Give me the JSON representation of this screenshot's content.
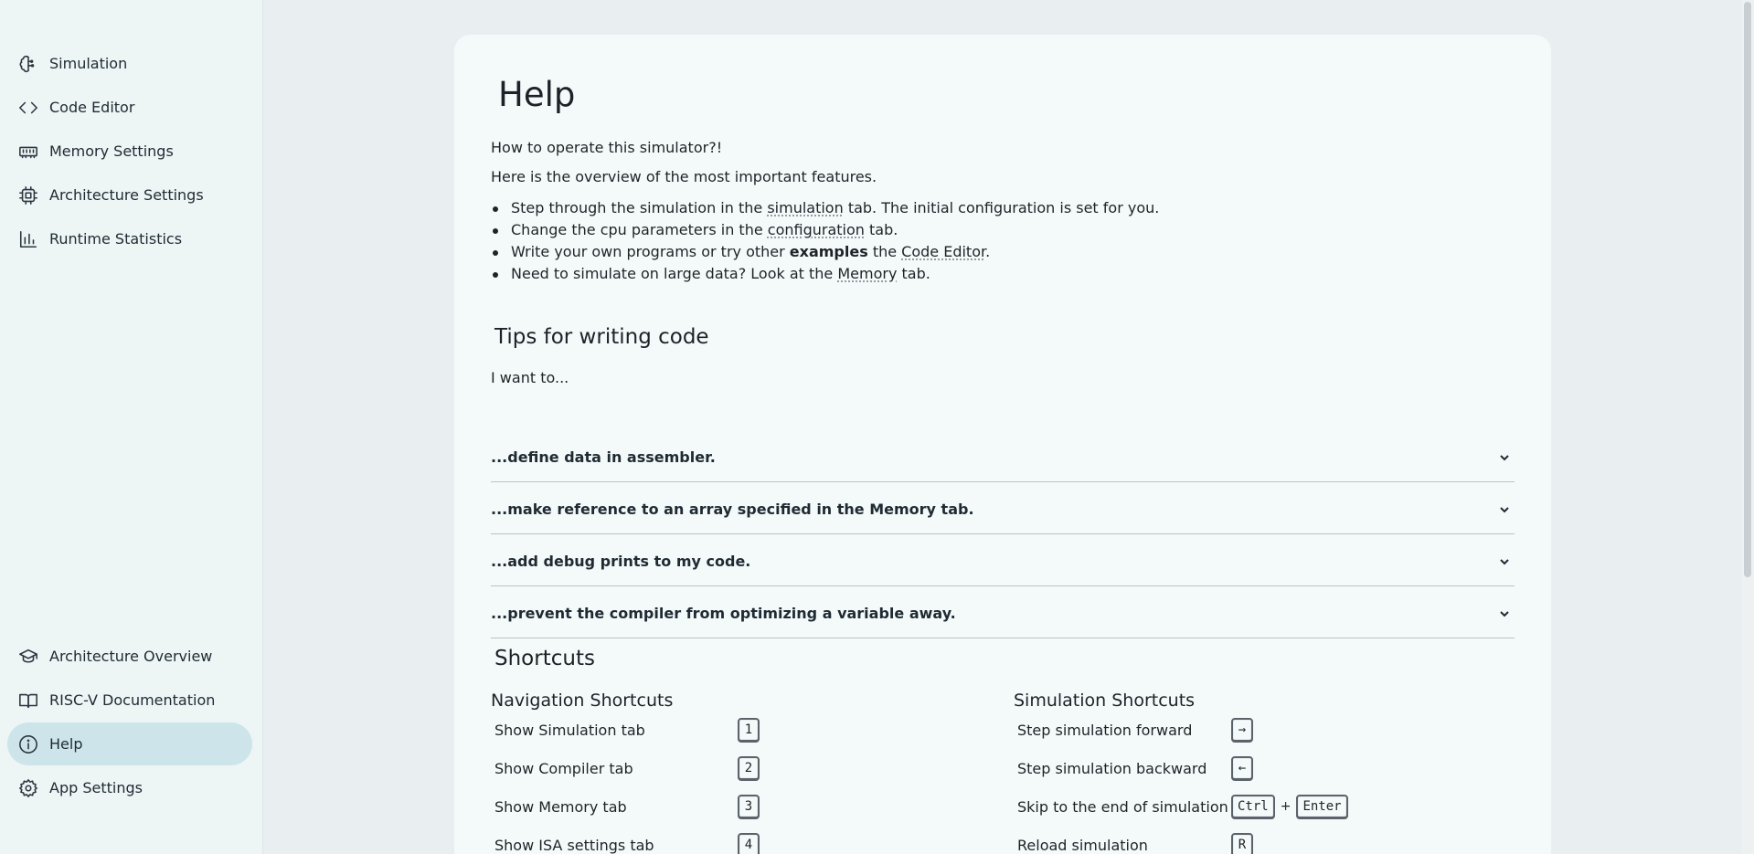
{
  "sidebar": {
    "top_items": [
      {
        "label": "Simulation",
        "icon": "brain-icon"
      },
      {
        "label": "Code Editor",
        "icon": "code-icon"
      },
      {
        "label": "Memory Settings",
        "icon": "memory-icon"
      },
      {
        "label": "Architecture Settings",
        "icon": "cpu-icon"
      },
      {
        "label": "Runtime Statistics",
        "icon": "bar-chart-icon"
      }
    ],
    "bottom_items": [
      {
        "label": "Architecture Overview",
        "icon": "graduation-cap-icon"
      },
      {
        "label": "RISC-V Documentation",
        "icon": "book-icon"
      },
      {
        "label": "Help",
        "icon": "info-icon",
        "active": true
      },
      {
        "label": "App Settings",
        "icon": "gear-icon"
      }
    ]
  },
  "help": {
    "title": "Help",
    "intro_question": "How to operate this simulator?!",
    "intro_overview": "Here is the overview of the most important features.",
    "features": [
      {
        "before": "Step through the simulation in the ",
        "link": "simulation",
        "bold": "",
        "after": " tab. The initial configuration is set for you."
      },
      {
        "before": "Change the cpu parameters in the ",
        "link": "configuration",
        "bold": "",
        "after": " tab."
      },
      {
        "before": "Write your own programs or try other ",
        "bold": "examples",
        "mid": " the ",
        "link": "Code Editor",
        "after": "."
      },
      {
        "before": "Need to simulate on large data? Look at the ",
        "link": "Memory",
        "bold": "",
        "after": " tab."
      }
    ],
    "tips_title": "Tips for writing code",
    "tips_intro": "I want to...",
    "tips": [
      "...define data in assembler.",
      "...make reference to an array specified in the Memory tab.",
      "...add debug prints to my code.",
      "...prevent the compiler from optimizing a variable away."
    ],
    "shortcuts_title": "Shortcuts",
    "navigation": {
      "title": "Navigation Shortcuts",
      "rows": [
        {
          "label": "Show Simulation tab",
          "keys": [
            "1"
          ]
        },
        {
          "label": "Show Compiler tab",
          "keys": [
            "2"
          ]
        },
        {
          "label": "Show Memory tab",
          "keys": [
            "3"
          ]
        },
        {
          "label": "Show ISA settings tab",
          "keys": [
            "4"
          ]
        }
      ]
    },
    "simulation": {
      "title": "Simulation Shortcuts",
      "rows": [
        {
          "label": "Step simulation forward",
          "keys": [
            "→"
          ]
        },
        {
          "label": "Step simulation backward",
          "keys": [
            "←"
          ]
        },
        {
          "label": "Skip to the end of simulation",
          "keys": [
            "Ctrl",
            "Enter"
          ]
        },
        {
          "label": "Reload simulation",
          "keys": [
            "R"
          ]
        }
      ]
    },
    "plus_sign": "+"
  }
}
